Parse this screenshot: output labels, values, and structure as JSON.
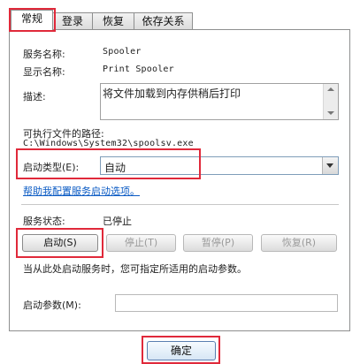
{
  "tabs": [
    {
      "label": "常规",
      "active": true
    },
    {
      "label": "登录",
      "active": false
    },
    {
      "label": "恢复",
      "active": false
    },
    {
      "label": "依存关系",
      "active": false
    }
  ],
  "general": {
    "service_name_label": "服务名称:",
    "service_name_value": "Spooler",
    "display_name_label": "显示名称:",
    "display_name_value": "Print Spooler",
    "description_label": "描述:",
    "description_value": "将文件加载到内存供稍后打印",
    "exe_path_label": "可执行文件的路径:",
    "exe_path_value": "C:\\Windows\\System32\\spoolsv.exe",
    "startup_type_label": "启动类型(E):",
    "startup_type_value": "自动",
    "help_link": "帮助我配置服务启动选项。"
  },
  "status": {
    "label": "服务状态:",
    "value": "已停止"
  },
  "buttons": {
    "start": "启动(S)",
    "stop": "停止(T)",
    "pause": "暂停(P)",
    "resume": "恢复(R)"
  },
  "hint": "当从此处启动服务时，您可指定所适用的启动参数。",
  "start_params_label": "启动参数(M):",
  "start_params_value": "",
  "ok_button": "确定",
  "colors": {
    "highlight": "#e0293a",
    "link": "#0b5bc4"
  }
}
